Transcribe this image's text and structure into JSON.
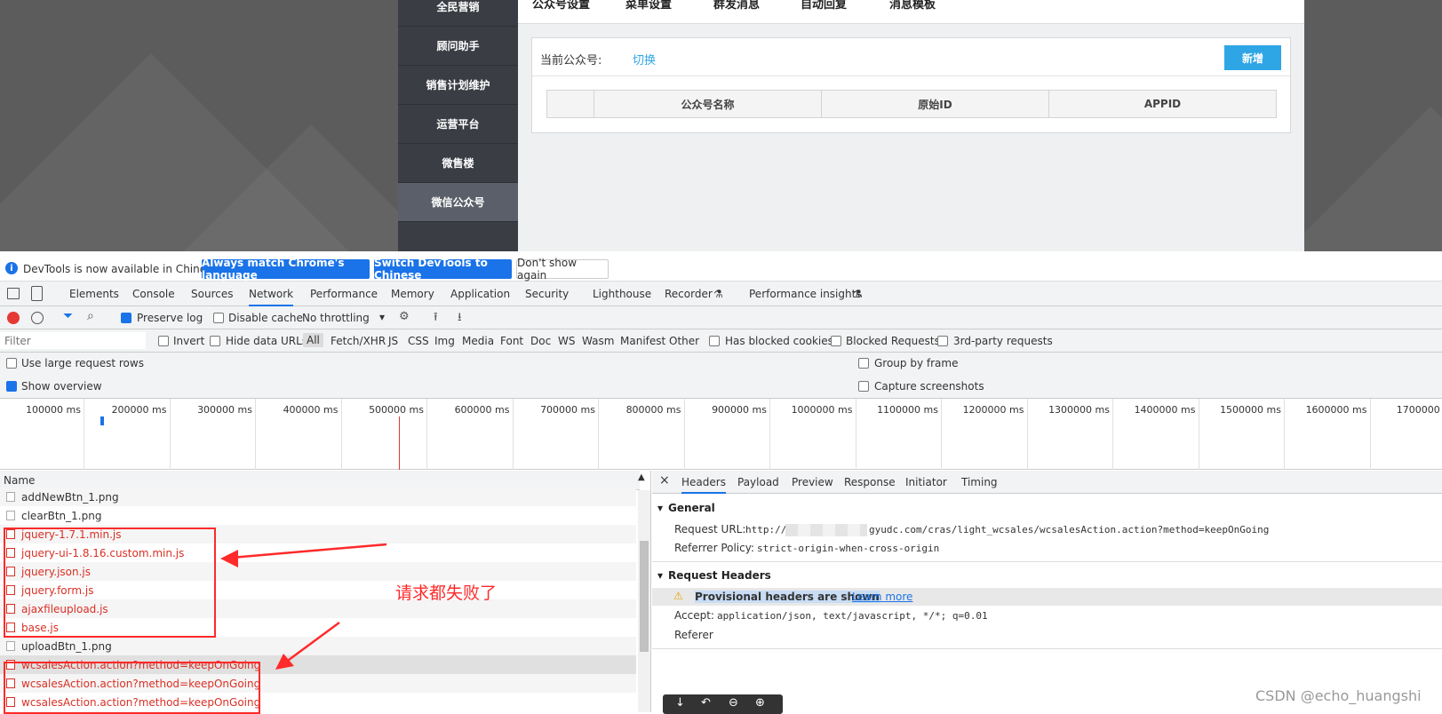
{
  "site": {
    "sidenav": [
      "全民营销",
      "顾问助手",
      "销售计划维护",
      "运营平台",
      "微售楼",
      "微信公众号"
    ],
    "tabs": [
      "公众号设置",
      "菜单设置",
      "群发消息",
      "自动回复",
      "消息模板"
    ],
    "current_label": "当前公众号:",
    "switch_link": "切换",
    "add_button": "新增",
    "table_headers": [
      "",
      "公众号名称",
      "原始ID",
      "APPID"
    ]
  },
  "infobar": {
    "message": "DevTools is now available in Chinese!",
    "btn_match": "Always match Chrome's language",
    "btn_switch": "Switch DevTools to Chinese",
    "btn_dismiss": "Don't show again"
  },
  "devtools_tabs": [
    "Elements",
    "Console",
    "Sources",
    "Network",
    "Performance",
    "Memory",
    "Application",
    "Security",
    "Lighthouse",
    "Recorder",
    "Performance insights"
  ],
  "toolbar": {
    "preserve_log": "Preserve log",
    "disable_cache": "Disable cache",
    "throttling": "No throttling"
  },
  "filterbar": {
    "placeholder": "Filter",
    "invert": "Invert",
    "hide_data_urls": "Hide data URLs",
    "types": [
      "All",
      "Fetch/XHR",
      "JS",
      "CSS",
      "Img",
      "Media",
      "Font",
      "Doc",
      "WS",
      "Wasm",
      "Manifest",
      "Other"
    ],
    "has_blocked_cookies": "Has blocked cookies",
    "blocked_requests": "Blocked Requests",
    "third_party": "3rd-party requests"
  },
  "options": {
    "large_rows": "Use large request rows",
    "show_overview": "Show overview",
    "group_by_frame": "Group by frame",
    "capture_screenshots": "Capture screenshots"
  },
  "overview_ticks": [
    "100000 ms",
    "200000 ms",
    "300000 ms",
    "400000 ms",
    "500000 ms",
    "600000 ms",
    "700000 ms",
    "800000 ms",
    "900000 ms",
    "1000000 ms",
    "1100000 ms",
    "1200000 ms",
    "1300000 ms",
    "1400000 ms",
    "1500000 ms",
    "1600000 ms",
    "1700000 m"
  ],
  "request_list": {
    "header": "Name",
    "rows": [
      {
        "name": "addNewBtn_1.png",
        "status": "ok"
      },
      {
        "name": "clearBtn_1.png",
        "status": "ok"
      },
      {
        "name": "jquery-1.7.1.min.js",
        "status": "failed"
      },
      {
        "name": "jquery-ui-1.8.16.custom.min.js",
        "status": "failed"
      },
      {
        "name": "jquery.json.js",
        "status": "failed"
      },
      {
        "name": "jquery.form.js",
        "status": "failed"
      },
      {
        "name": "ajaxfileupload.js",
        "status": "failed"
      },
      {
        "name": "base.js",
        "status": "failed"
      },
      {
        "name": "uploadBtn_1.png",
        "status": "ok"
      },
      {
        "name": "wcsalesAction.action?method=keepOnGoing",
        "status": "failed"
      },
      {
        "name": "wcsalesAction.action?method=keepOnGoing",
        "status": "failed"
      },
      {
        "name": "wcsalesAction.action?method=keepOnGoing",
        "status": "failed"
      }
    ]
  },
  "details": {
    "close": "×",
    "tabs": [
      "Headers",
      "Payload",
      "Preview",
      "Response",
      "Initiator",
      "Timing"
    ],
    "general_title": "General",
    "request_url_label": "Request URL:",
    "request_url_prefix": "http://",
    "request_url_suffix": "gyudc.com/cras/light_wcsales/wcsalesAction.action?method=keepOnGoing",
    "referrer_policy_label": "Referrer Policy:",
    "referrer_policy": "strict-origin-when-cross-origin",
    "request_headers_title": "Request Headers",
    "provisional": "Provisional headers are shown",
    "learn_more": "Learn more",
    "accept_label": "Accept:",
    "accept_value": "application/json, text/javascript, */*; q=0.01",
    "referer_label": "Referer"
  },
  "annotation": "请求都失败了",
  "watermark": "CSDN @echo_huangshi",
  "colors": {
    "error": "#d93025",
    "annotation": "#ff2a2a",
    "accent": "#1a73e8",
    "site_button": "#2ea6e6"
  }
}
